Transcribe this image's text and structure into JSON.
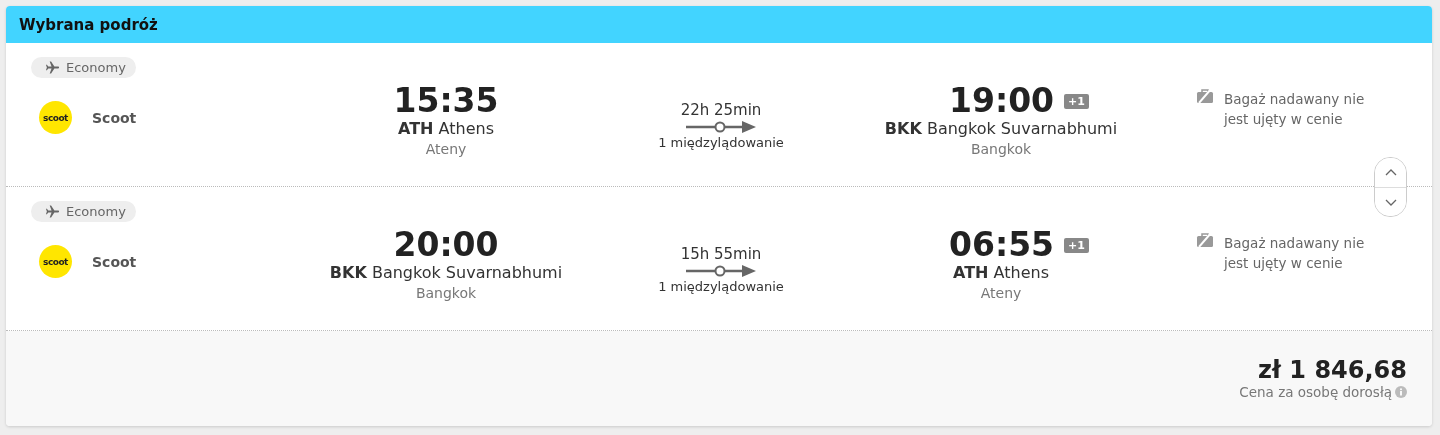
{
  "title": "Wybrana podróż",
  "legs": [
    {
      "cabin": "Economy",
      "airline": {
        "logo_text": "scoot",
        "name": "Scoot"
      },
      "departure": {
        "time": "15:35",
        "code": "ATH",
        "airport": "Athens",
        "city": "Ateny"
      },
      "duration": "22h 25min",
      "stops": "1 międzylądowanie",
      "arrival": {
        "time": "19:00",
        "day_offset": "+1",
        "code": "BKK",
        "airport": "Bangkok Suvarnabhumi",
        "city": "Bangkok"
      },
      "baggage": "Bagaż nadawany nie jest ujęty w cenie"
    },
    {
      "cabin": "Economy",
      "airline": {
        "logo_text": "scoot",
        "name": "Scoot"
      },
      "departure": {
        "time": "20:00",
        "code": "BKK",
        "airport": "Bangkok Suvarnabhumi",
        "city": "Bangkok"
      },
      "duration": "15h 55min",
      "stops": "1 międzylądowanie",
      "arrival": {
        "time": "06:55",
        "day_offset": "+1",
        "code": "ATH",
        "airport": "Athens",
        "city": "Ateny"
      },
      "baggage": "Bagaż nadawany nie jest ujęty w cenie"
    }
  ],
  "price": {
    "amount": "zł 1 846,68",
    "note": "Cena za osobę dorosłą"
  }
}
